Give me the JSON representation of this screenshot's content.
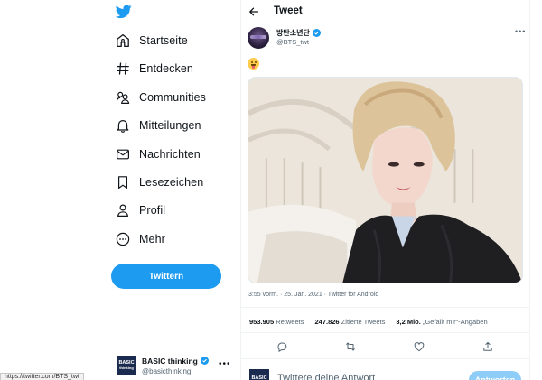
{
  "sidebar": {
    "logo_icon": "twitter-bird-icon",
    "items": [
      {
        "label": "Startseite",
        "icon": "home-icon"
      },
      {
        "label": "Entdecken",
        "icon": "hashtag-icon"
      },
      {
        "label": "Communities",
        "icon": "communities-icon"
      },
      {
        "label": "Mitteilungen",
        "icon": "bell-icon"
      },
      {
        "label": "Nachrichten",
        "icon": "envelope-icon"
      },
      {
        "label": "Lesezeichen",
        "icon": "bookmark-icon"
      },
      {
        "label": "Profil",
        "icon": "person-icon"
      },
      {
        "label": "Mehr",
        "icon": "more-circle-icon"
      }
    ],
    "tweet_button": "Twittern",
    "account": {
      "avatar_text_1": "BASIC",
      "avatar_text_2": "thinking",
      "name": "BASIC thinking",
      "handle": "@basicthinking"
    }
  },
  "status_url": "https://twitter.com/BTS_twt",
  "main": {
    "header_title": "Tweet",
    "author": {
      "name": "방탄소년단",
      "handle": "@BTS_twt",
      "verified": true
    },
    "tweet_text_emoji": "😛",
    "photo_description_icon": "selfie-photo",
    "meta": "3:55 vorm. · 25. Jan. 2021 · Twitter for Android",
    "stats": {
      "retweets_count": "953.905",
      "retweets_label": "Retweets",
      "quotes_count": "247.826",
      "quotes_label": "Zitierte Tweets",
      "likes_count": "3,2 Mio.",
      "likes_label": "„Gefällt mir“-Angaben"
    },
    "reply": {
      "placeholder": "Twittere deine Antwort",
      "button": "Antworten"
    }
  },
  "colors": {
    "accent": "#1d9bf0",
    "text": "#0f1419",
    "secondary": "#536471"
  }
}
